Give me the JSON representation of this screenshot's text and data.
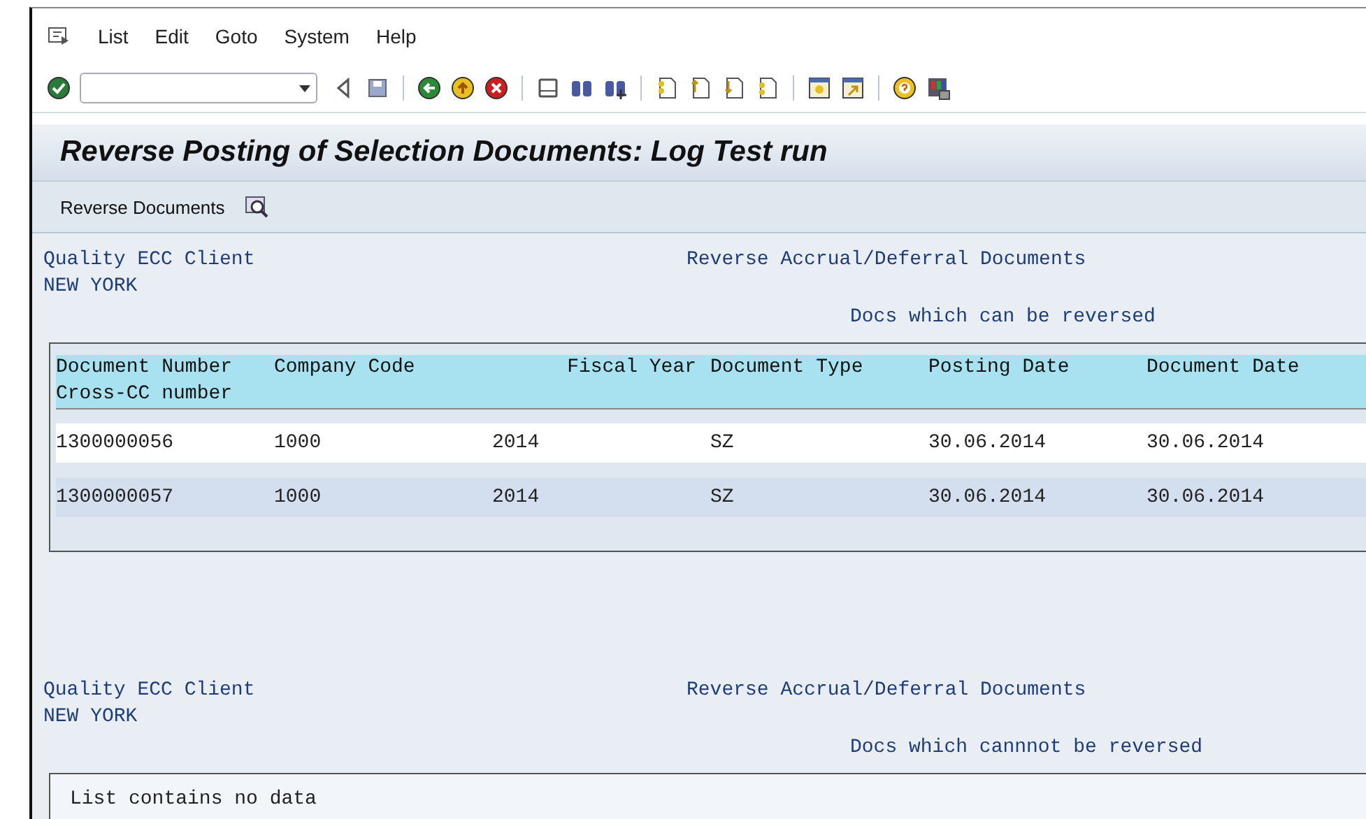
{
  "menu": [
    "List",
    "Edit",
    "Goto",
    "System",
    "Help"
  ],
  "title": "Reverse Posting of Selection Documents: Log Test run",
  "app_toolbar": {
    "button": "Reverse Documents"
  },
  "sections": [
    {
      "client": "Quality ECC Client",
      "city": "NEW YORK",
      "report": "Reverse Accrual/Deferral Documents",
      "subtitle": "Docs which can be reversed",
      "table": {
        "columns": [
          "Document Number",
          "Company Code",
          "Fiscal Year",
          "Document Type",
          "Posting Date",
          "Document Date"
        ],
        "header_line_2": "Cross-CC number",
        "rows": [
          [
            "1300000056",
            "1000",
            "2014",
            "SZ",
            "30.06.2014",
            "30.06.2014"
          ],
          [
            "1300000057",
            "1000",
            "2014",
            "SZ",
            "30.06.2014",
            "30.06.2014"
          ]
        ]
      }
    },
    {
      "client": "Quality ECC Client",
      "city": "NEW YORK",
      "report": "Reverse Accrual/Deferral Documents",
      "subtitle": "Docs which cannnot be reversed",
      "message": "List contains no data"
    }
  ]
}
